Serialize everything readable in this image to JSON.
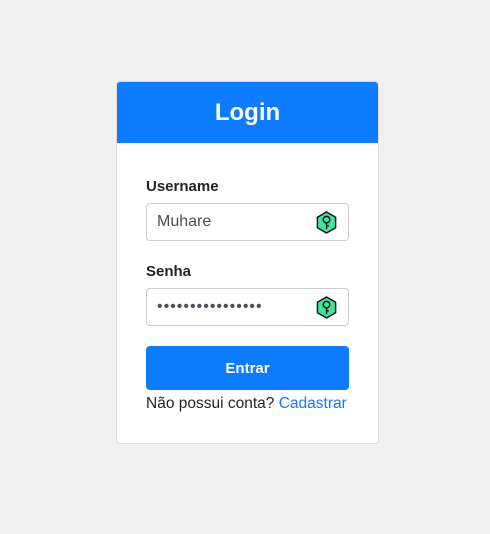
{
  "login": {
    "title": "Login",
    "username": {
      "label": "Username",
      "value": "Muhare",
      "icon": "key-icon"
    },
    "password": {
      "label": "Senha",
      "value": "••••••••••••••••",
      "icon": "key-icon"
    },
    "submit_label": "Entrar",
    "signup_prompt": "Não possui conta?",
    "signup_link": "Cadastrar"
  },
  "colors": {
    "primary": "#0d7bff",
    "icon_fill": "#3ee4a2",
    "page_background": "#f0f0f0"
  }
}
